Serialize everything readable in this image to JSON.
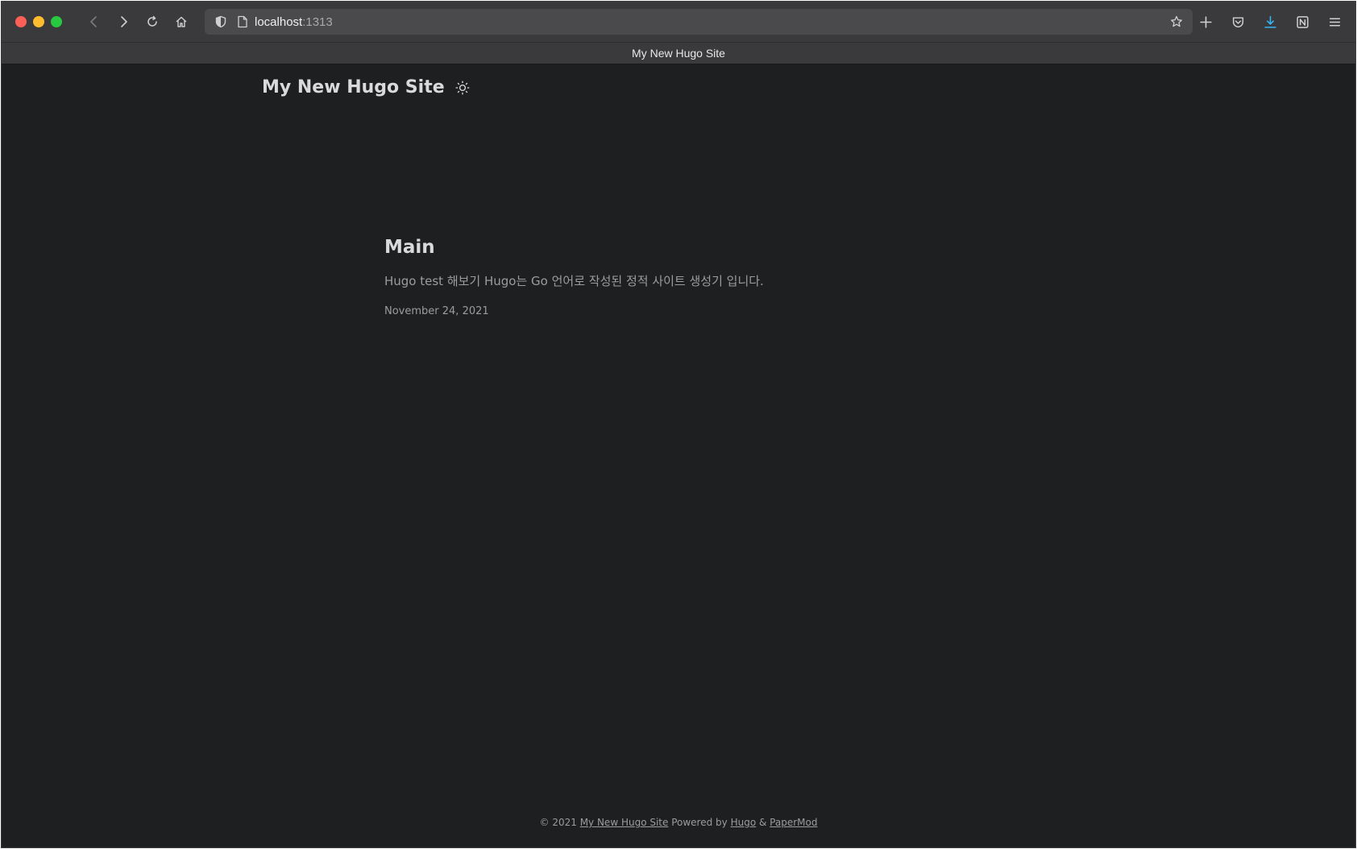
{
  "browser": {
    "url_host": "localhost",
    "url_port": ":1313",
    "tab_title": "My New Hugo Site",
    "accent_download": "#35b4f0"
  },
  "site": {
    "title": "My New Hugo Site",
    "theme_toggle_icon": "sun-icon"
  },
  "post": {
    "title": "Main",
    "summary": "Hugo test 해보기 Hugo는 Go 언어로 작성된 정적 사이트 생성기 입니다.",
    "date": "November 24, 2021"
  },
  "footer": {
    "copyright": "© 2021 ",
    "site_link": "My New Hugo Site",
    "powered_by": " Powered by ",
    "hugo_link": "Hugo",
    "amp": " & ",
    "theme_link": "PaperMod"
  }
}
